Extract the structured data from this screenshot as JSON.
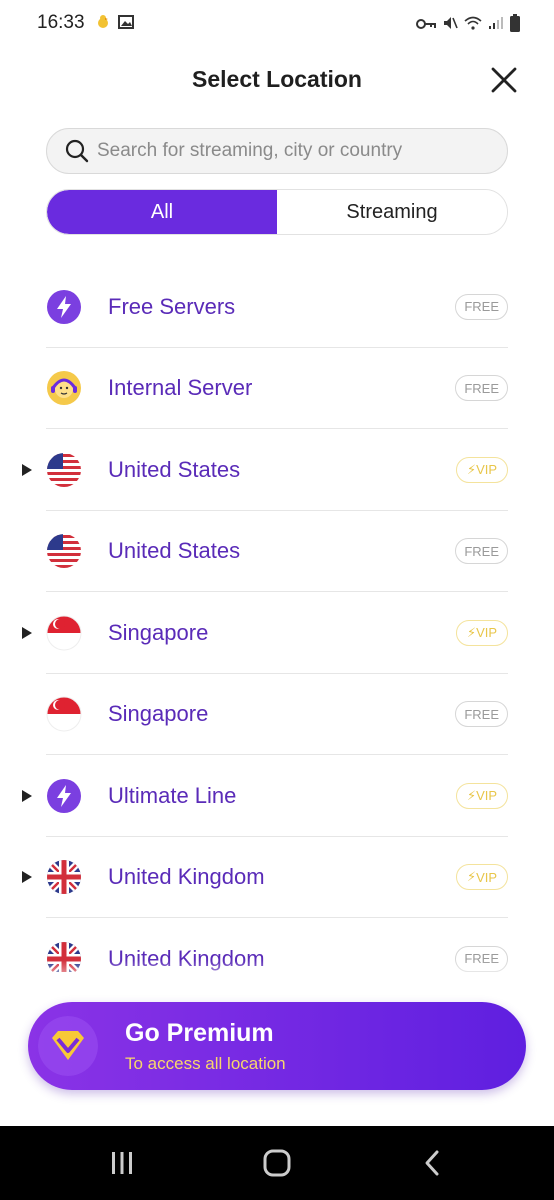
{
  "status_bar": {
    "time": "16:33",
    "left_icons": [
      "notification-chick-icon",
      "gallery-icon"
    ],
    "right_icons": [
      "vpn-key-icon",
      "mute-icon",
      "wifi-icon",
      "signal-icon",
      "battery-icon"
    ]
  },
  "header": {
    "title": "Select Location",
    "close_icon": "close-icon"
  },
  "search": {
    "placeholder": "Search for streaming, city or country",
    "value": ""
  },
  "tabs": [
    {
      "label": "All",
      "active": true
    },
    {
      "label": "Streaming",
      "active": false
    }
  ],
  "locations": [
    {
      "label": "Free Servers",
      "icon": "lightning-icon",
      "badge": "FREE",
      "badge_type": "free",
      "expandable": false
    },
    {
      "label": "Internal Server",
      "icon": "support-agent-icon",
      "badge": "FREE",
      "badge_type": "free",
      "expandable": false
    },
    {
      "label": "United States",
      "icon": "us-flag-icon",
      "badge": "VIP",
      "badge_type": "vip",
      "expandable": true
    },
    {
      "label": "United States",
      "icon": "us-flag-icon",
      "badge": "FREE",
      "badge_type": "free",
      "expandable": false
    },
    {
      "label": "Singapore",
      "icon": "sg-flag-icon",
      "badge": "VIP",
      "badge_type": "vip",
      "expandable": true
    },
    {
      "label": "Singapore",
      "icon": "sg-flag-icon",
      "badge": "FREE",
      "badge_type": "free",
      "expandable": false
    },
    {
      "label": "Ultimate Line",
      "icon": "lightning-icon",
      "badge": "VIP",
      "badge_type": "vip",
      "expandable": true
    },
    {
      "label": "United Kingdom",
      "icon": "uk-flag-icon",
      "badge": "VIP",
      "badge_type": "vip",
      "expandable": true
    },
    {
      "label": "United Kingdom",
      "icon": "uk-flag-icon",
      "badge": "FREE",
      "badge_type": "free",
      "expandable": false
    }
  ],
  "premium": {
    "title": "Go Premium",
    "subtitle": "To access all location",
    "icon": "diamond-icon"
  },
  "nav_bar": {
    "icons": [
      "recent-apps-icon",
      "home-icon",
      "back-icon"
    ]
  },
  "colors": {
    "accent": "#6a2bdf",
    "label": "#5a2bb8",
    "vip": "#e8c64a",
    "premium_subtitle": "#f8d76a"
  }
}
